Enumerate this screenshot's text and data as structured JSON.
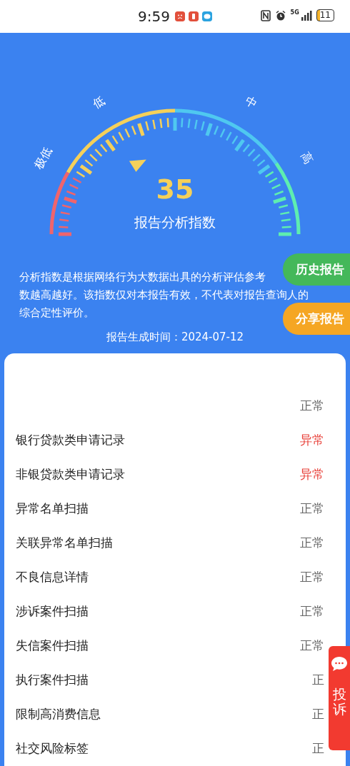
{
  "status_bar": {
    "time": "9:59",
    "network": "5G",
    "battery": "11"
  },
  "gauge": {
    "labels": [
      "极低",
      "低",
      "中",
      "高"
    ],
    "score": "35",
    "caption": "报告分析指数"
  },
  "description": [
    "分析指数是根据网络行为大数据出具的分析评估参考",
    "数越高越好。该指数仅对本报告有效，不代表对报告查询人的",
    "综合定性评价。"
  ],
  "generated": "报告生成时间：2024-07-12",
  "side_buttons": [
    {
      "label": "历史报告",
      "color": "#44b85a"
    },
    {
      "label": "分享报告",
      "color": "#f5a623"
    }
  ],
  "items": [
    {
      "status": "正常",
      "alert": false
    },
    {
      "label": "银行贷款类申请记录",
      "status": "异常",
      "alert": true
    },
    {
      "label": "非银贷款类申请记录",
      "status": "异常",
      "alert": true
    },
    {
      "label": "异常名单扫描",
      "status": "正常",
      "alert": false
    },
    {
      "label": "关联异常名单扫描",
      "status": "正常",
      "alert": false
    },
    {
      "label": "不良信息详情",
      "status": "正常",
      "alert": false
    },
    {
      "label": "涉诉案件扫描",
      "status": "正常",
      "alert": false
    },
    {
      "label": "失信案件扫描",
      "status": "正常",
      "alert": false
    },
    {
      "label": "执行案件扫描",
      "status": "正",
      "alert": false
    },
    {
      "label": "限制高消费信息",
      "status": "正",
      "alert": false
    },
    {
      "label": "社交风险标签",
      "status": "正",
      "alert": false
    }
  ],
  "complaint": {
    "label": "投诉"
  }
}
